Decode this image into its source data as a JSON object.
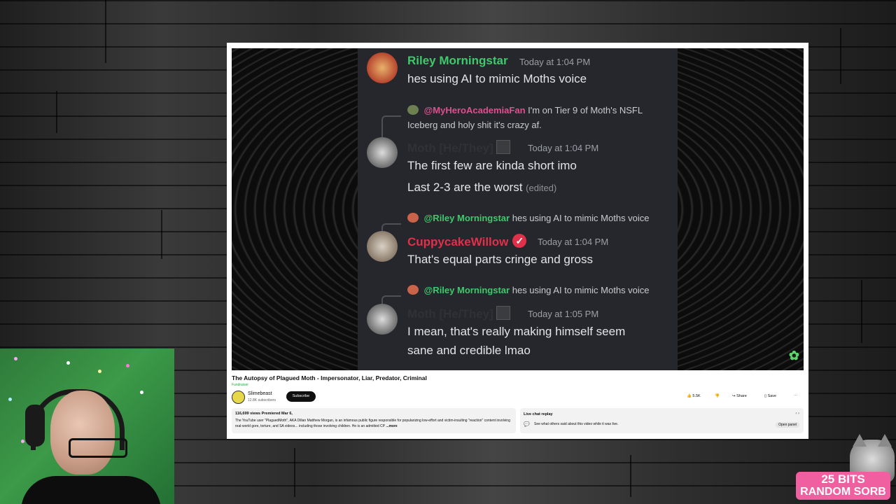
{
  "video": {
    "chat": {
      "messages": [
        {
          "name": "Riley Morningstar",
          "time": "Today at 1:04 PM",
          "lines": [
            "hes using AI to mimic Moths voice"
          ]
        },
        {
          "reply_mention": "@MyHeroAcademiaFan",
          "reply_text": "I'm on Tier 9 of Moth's NSFL",
          "reply_text2": "Iceberg and holy shit it's crazy af.",
          "name": "Moth [He/They]",
          "time": "Today at 1:04 PM",
          "lines": [
            "The first few are kinda short imo",
            "Last 2-3 are the worst"
          ],
          "edited": "(edited)"
        },
        {
          "reply_mention": "@Riley Morningstar",
          "reply_text": "hes using AI to mimic Moths voice",
          "name": "CuppycakeWillow",
          "time": "Today at 1:04 PM",
          "lines": [
            "That's equal parts cringe and gross"
          ]
        },
        {
          "reply_mention": "@Riley Morningstar",
          "reply_text": "hes using AI to mimic Moths voice",
          "name": "Moth [He/They]",
          "time": "Today at 1:05 PM",
          "lines": [
            "I mean, that's really making himself seem",
            "sane and credible lmao"
          ]
        }
      ]
    },
    "title": "The Autopsy of Plagued Moth - Impersonator, Liar, Predator, Criminal",
    "subtitle": "Fundraiser"
  },
  "channel": {
    "name": "Slimebeast",
    "subs": "12.8K subscribers",
    "subscribe_label": "Subscribe"
  },
  "actions": {
    "likes": "5.5K",
    "share": "Share",
    "save": "Save",
    "more": "⋯"
  },
  "description": {
    "stats": "116,699 views  Premiered Mar 6,",
    "text": "The YouTube user \"PlaguedMoth\", AKA Dillan Matthew Morgan, is an infamous public figure responsible for popularizing low-effort and victim-insulting \"reaction\" content involving real-world gore, torture, and SA videos... including those involving children. He is an admitted CP",
    "more": "...more"
  },
  "livechat": {
    "title": "Live chat replay",
    "text": "See what others said about this video while it was live.",
    "open": "Open panel"
  },
  "badge": {
    "line1": "25 BITS",
    "line2": "RANDOM SORB"
  }
}
